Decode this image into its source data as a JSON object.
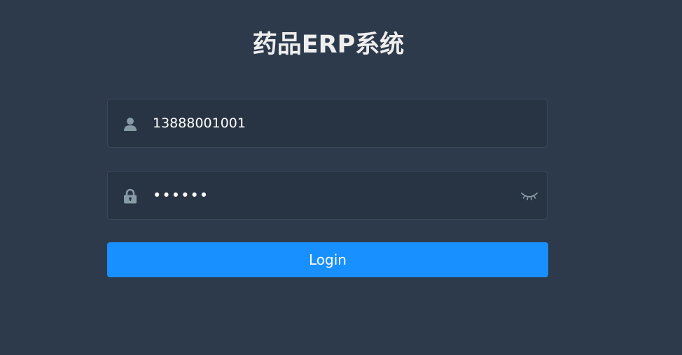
{
  "app": {
    "title": "药品ERP系统"
  },
  "form": {
    "username": {
      "value": "13888001001",
      "icon": "user-icon"
    },
    "password": {
      "value": "123456",
      "icon": "lock-icon",
      "toggle_icon": "eye-closed-icon"
    },
    "login_button": {
      "label": "Login"
    }
  },
  "colors": {
    "background": "#2d3a4b",
    "field_background": "#283443",
    "icon": "#889aa4",
    "accent": "#1890ff",
    "title": "#eeeeee"
  }
}
